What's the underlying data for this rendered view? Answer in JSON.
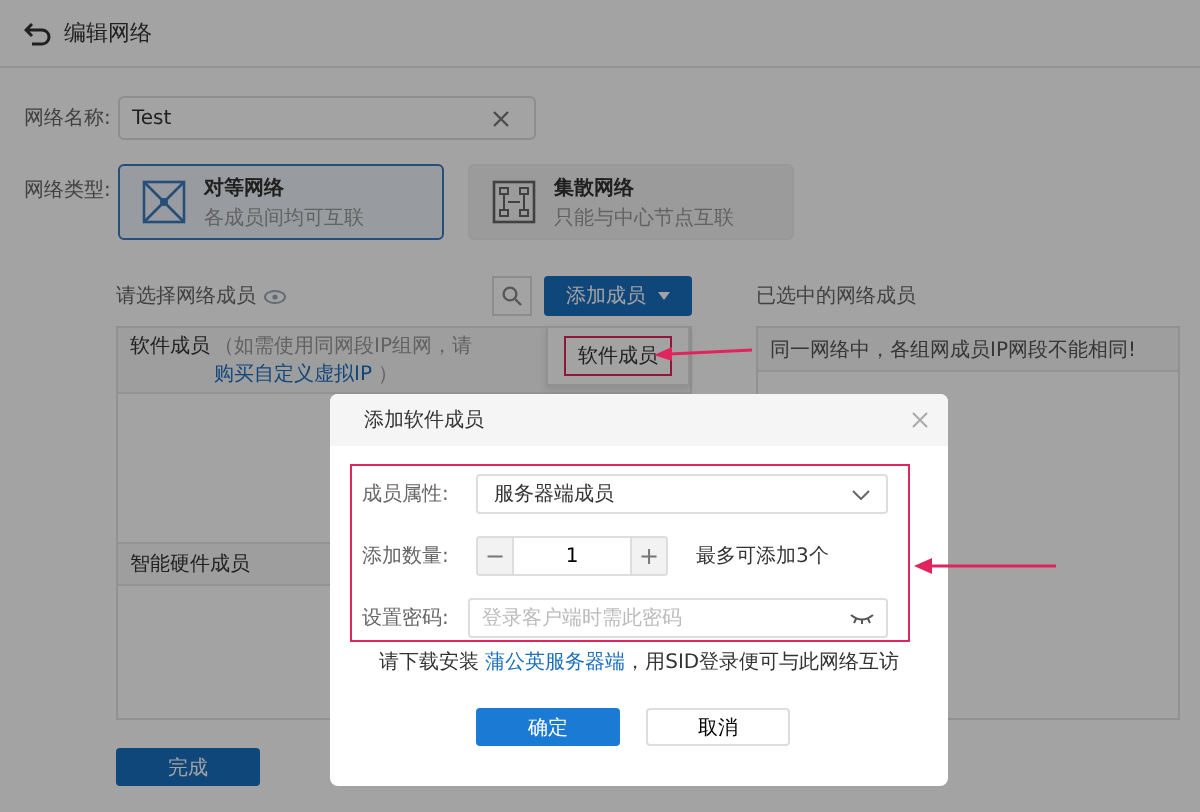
{
  "header": {
    "title": "编辑网络"
  },
  "form": {
    "name_label": "网络名称:",
    "name_value": "Test",
    "type_label": "网络类型:",
    "types": [
      {
        "title": "对等网络",
        "subtitle": "各成员间均可互联",
        "selected": true
      },
      {
        "title": "集散网络",
        "subtitle": "只能与中心节点互联",
        "selected": false
      }
    ]
  },
  "members": {
    "left_label": "请选择网络成员",
    "add_button": "添加成员",
    "menu": [
      "软件成员"
    ],
    "software_title": "软件成员",
    "software_note_before": "（如需使用同网段IP组网，请 ",
    "software_link": "购买自定义虚拟IP",
    "software_note_after": " ）",
    "hardware_title": "智能硬件成员",
    "right_label": "已选中的网络成员",
    "right_notice": "同一网络中，各组网成员IP网段不能相同!"
  },
  "done_button": "完成",
  "dialog": {
    "title": "添加软件成员",
    "fields": [
      {
        "kind": "select",
        "label": "成员属性:",
        "value": "服务器端成员"
      },
      {
        "kind": "stepper",
        "label": "添加数量:",
        "value": "1",
        "minus": "−",
        "plus": "+",
        "hint": "最多可添加3个"
      },
      {
        "kind": "password",
        "label": "设置密码:",
        "placeholder": "登录客户端时需此密码"
      }
    ],
    "note_before": "请下载安装 ",
    "note_link": "蒲公英服务器端",
    "note_after": "，用SID登录便可与此网络互访",
    "buttons": [
      {
        "label": "确定",
        "primary": true
      },
      {
        "label": "取消",
        "primary": false
      }
    ]
  }
}
